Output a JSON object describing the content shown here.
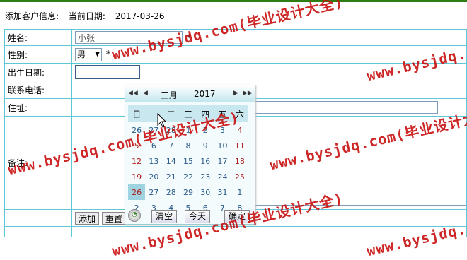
{
  "header": {
    "title": "添加客户信息:",
    "date_label": "当前日期:",
    "date_value": "2017-03-26"
  },
  "form": {
    "name_label": "姓名:",
    "name_value": "小张",
    "required_mark": "*",
    "gender_label": "性别:",
    "gender_value": "男",
    "birth_label": "出生日期:",
    "birth_value": "",
    "phone_label": "联系电话:",
    "phone_value": "",
    "address_label": "住址:",
    "address_value": "",
    "notes_label": "备注:",
    "notes_value": "",
    "add_button": "添加",
    "reset_button": "重置"
  },
  "calendar": {
    "month": "三月",
    "year": "2017",
    "weekdays": [
      "日",
      "一",
      "二",
      "三",
      "四",
      "五",
      "六"
    ],
    "weeks": [
      [
        "26",
        "27",
        "28",
        "1",
        "2",
        "3",
        "4"
      ],
      [
        "5",
        "6",
        "7",
        "8",
        "9",
        "10",
        "11"
      ],
      [
        "12",
        "13",
        "14",
        "15",
        "16",
        "17",
        "18"
      ],
      [
        "19",
        "20",
        "21",
        "22",
        "23",
        "24",
        "25"
      ],
      [
        "26",
        "27",
        "28",
        "29",
        "30",
        "31",
        "1"
      ],
      [
        "2",
        "3",
        "4",
        "5",
        "6",
        "7",
        "8"
      ]
    ],
    "today": "26",
    "clear_button": "清空",
    "today_button": "今天",
    "confirm_button": "确定"
  },
  "watermark": {
    "text": "www.bysjdq.com(毕业设计大全)"
  },
  "colors": {
    "accent": "#5ec8d8",
    "weekend": "#b02020",
    "watermark": "#c81010",
    "topbar": "#2e7d12"
  }
}
